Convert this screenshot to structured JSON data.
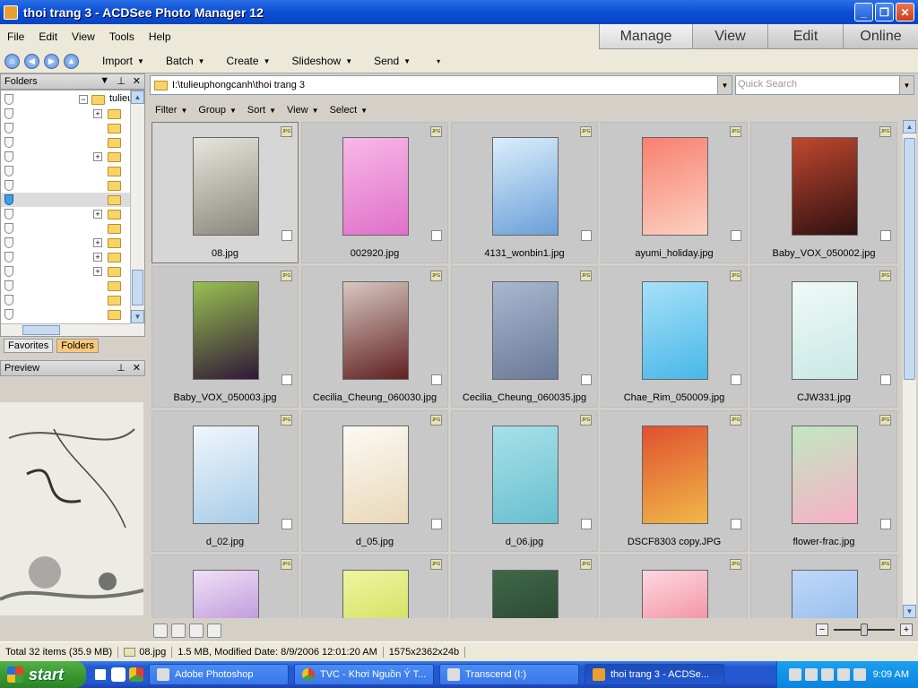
{
  "window": {
    "title": "thoi trang 3 - ACDSee Photo Manager 12"
  },
  "menu": [
    "File",
    "Edit",
    "View",
    "Tools",
    "Help"
  ],
  "mode_tabs": [
    "Manage",
    "View",
    "Edit",
    "Online"
  ],
  "toolbar": [
    "Import",
    "Batch",
    "Create",
    "Slideshow",
    "Send"
  ],
  "folders_pane": {
    "title": "Folders",
    "tree_top": "tulieu",
    "tabs": [
      "Favorites",
      "Folders"
    ]
  },
  "preview_pane": {
    "title": "Preview"
  },
  "path": "I:\\tulieuphongcanh\\thoi trang 3",
  "search_placeholder": "Quick Search",
  "filter_bar": [
    "Filter",
    "Group",
    "Sort",
    "View",
    "Select"
  ],
  "files": [
    {
      "name": "08.jpg",
      "colors": [
        "#e8e6dc",
        "#8a887c"
      ]
    },
    {
      "name": "002920.jpg",
      "colors": [
        "#f8b8e8",
        "#e070c8"
      ]
    },
    {
      "name": "4131_wonbin1.jpg",
      "colors": [
        "#dceefc",
        "#6aa0d8"
      ]
    },
    {
      "name": "ayumi_holiday.jpg",
      "colors": [
        "#f88070",
        "#fcd0c0"
      ]
    },
    {
      "name": "Baby_VOX_050002.jpg",
      "colors": [
        "#c04830",
        "#301010"
      ]
    },
    {
      "name": "Baby_VOX_050003.jpg",
      "colors": [
        "#98c050",
        "#301838"
      ]
    },
    {
      "name": "Cecilia_Cheung_060030.jpg",
      "colors": [
        "#d8c8c0",
        "#602020"
      ]
    },
    {
      "name": "Cecilia_Cheung_060035.jpg",
      "colors": [
        "#a8b8d0",
        "#6a7a98"
      ]
    },
    {
      "name": "Chae_Rim_050009.jpg",
      "colors": [
        "#a8e0f8",
        "#48b8e8"
      ]
    },
    {
      "name": "CJW331.jpg",
      "colors": [
        "#f0faf8",
        "#c8e8e4"
      ]
    },
    {
      "name": "d_02.jpg",
      "colors": [
        "#f0f6fc",
        "#a8cce8"
      ]
    },
    {
      "name": "d_05.jpg",
      "colors": [
        "#fcfaf4",
        "#e8d8b8"
      ]
    },
    {
      "name": "d_06.jpg",
      "colors": [
        "#a8e0e8",
        "#68c0d0"
      ]
    },
    {
      "name": "DSCF8303 copy.JPG",
      "colors": [
        "#e05030",
        "#f0b848"
      ]
    },
    {
      "name": "flower-frac.jpg",
      "colors": [
        "#c0e8c0",
        "#f8b0c8"
      ]
    },
    {
      "name": "",
      "colors": [
        "#f0e0f8",
        "#a070c8"
      ]
    },
    {
      "name": "",
      "colors": [
        "#f0f4a0",
        "#c0d840"
      ]
    },
    {
      "name": "",
      "colors": [
        "#406848",
        "#203828"
      ]
    },
    {
      "name": "",
      "colors": [
        "#fcd8e0",
        "#f06880"
      ]
    },
    {
      "name": "",
      "colors": [
        "#c0d8f8",
        "#80b0e8"
      ]
    }
  ],
  "badge": "JPG",
  "status": {
    "total": "Total 32 items  (35.9 MB)",
    "file": "08.jpg",
    "info": "1.5 MB, Modified Date: 8/9/2006 12:01:20 AM",
    "dims": "1575x2362x24b"
  },
  "taskbar": {
    "start": "start",
    "tasks": [
      "Adobe Photoshop",
      "TVC - Khơi Nguồn Ý T...",
      "Transcend (I:)",
      "thoi trang 3 - ACDSe..."
    ],
    "clock": "9:09 AM"
  }
}
